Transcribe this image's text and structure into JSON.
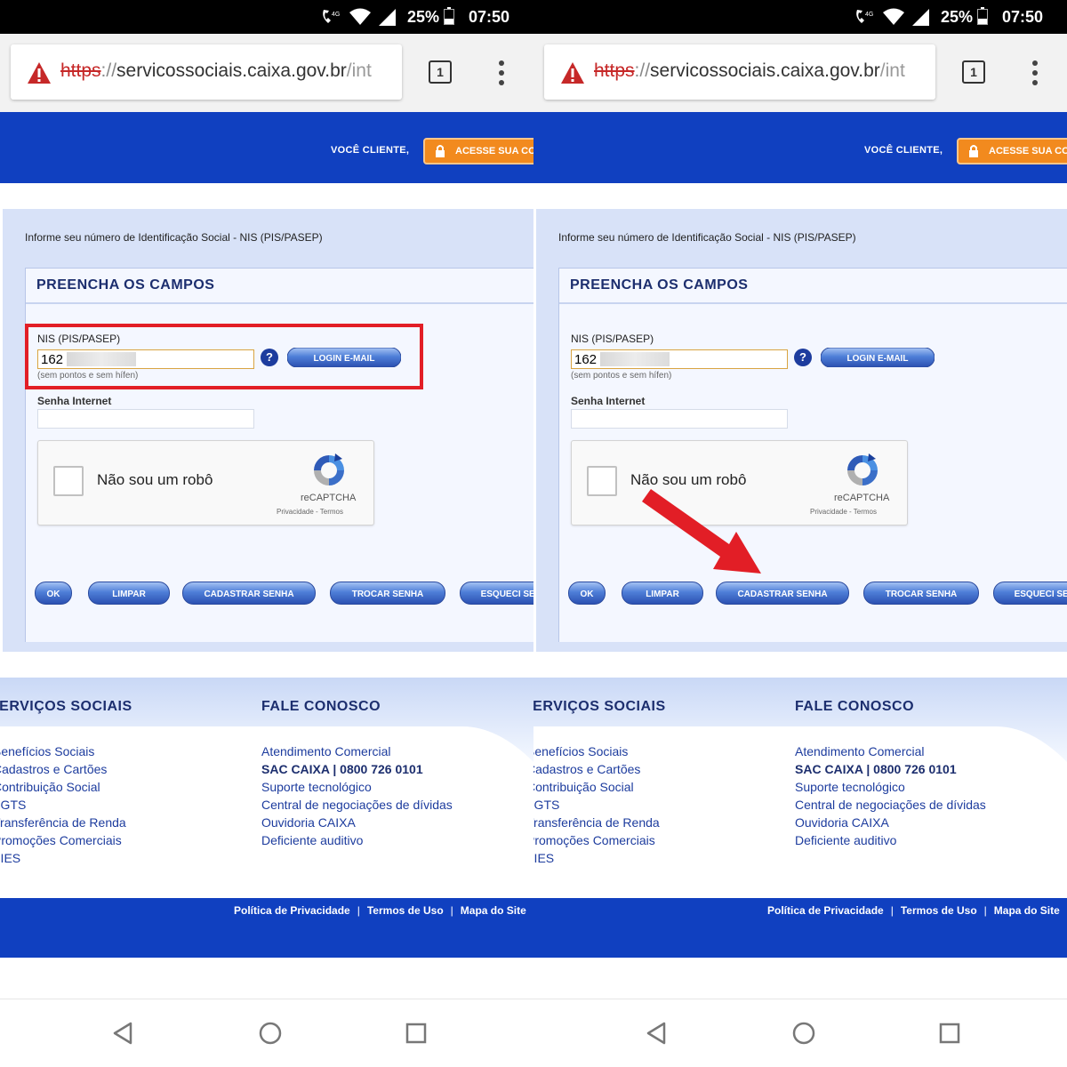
{
  "status_bar": {
    "network": "4G",
    "battery": "25%",
    "time": "07:50"
  },
  "browser": {
    "url_protocol": "https",
    "url_separator": "://",
    "url_host": "servicossociais.caixa.gov.br",
    "url_path": "/int",
    "tab_count": "1"
  },
  "header": {
    "cliente_label": "VOCÊ CLIENTE,",
    "acesse_label": "ACESSE SUA CONTA"
  },
  "form": {
    "instruction": "Informe seu número de Identificação Social - NIS (PIS/PASEP)",
    "title": "PREENCHA OS CAMPOS",
    "nis_label": "NIS (PIS/PASEP)",
    "nis_value": "162",
    "nis_hint": "(sem pontos e sem hífen)",
    "help_icon": "?",
    "login_email": "LOGIN E-MAIL",
    "senha_label": "Senha Internet",
    "captcha_label": "Não sou um robô",
    "captcha_brand": "reCAPTCHA",
    "captcha_links": "Privacidade - Termos",
    "buttons": {
      "ok": "OK",
      "limpar": "LIMPAR",
      "cadastrar": "CADASTRAR SENHA",
      "trocar": "TROCAR SENHA",
      "esqueci": "ESQUECI SENHA"
    }
  },
  "footer": {
    "servicos_title": "SERVIÇOS SOCIAIS",
    "servicos_links": [
      "Benefícios Sociais",
      "Cadastros e Cartões",
      "Contribuição Social",
      "FGTS",
      "Transferência de Renda",
      "Promoções Comerciais",
      "FIES"
    ],
    "fale_title": "FALE CONOSCO",
    "fale_links": [
      "Atendimento Comercial",
      "SAC CAIXA | 0800 726 0101",
      "Suporte tecnológico",
      "Central de negociações de dívidas",
      "Ouvidoria CAIXA",
      "Deficiente auditivo"
    ],
    "bottom_links": [
      "Política de Privacidade",
      "Termos de Uso",
      "Mapa do Site"
    ]
  },
  "colors": {
    "brand_blue": "#1040c0",
    "title_navy": "#1c2e6e",
    "accent_orange": "#f28a1e",
    "highlight_red": "#e21e26"
  },
  "icons": [
    "warning-icon",
    "lock-icon",
    "help-icon",
    "recaptcha-icon",
    "back-icon",
    "home-icon",
    "recent-apps-icon"
  ]
}
